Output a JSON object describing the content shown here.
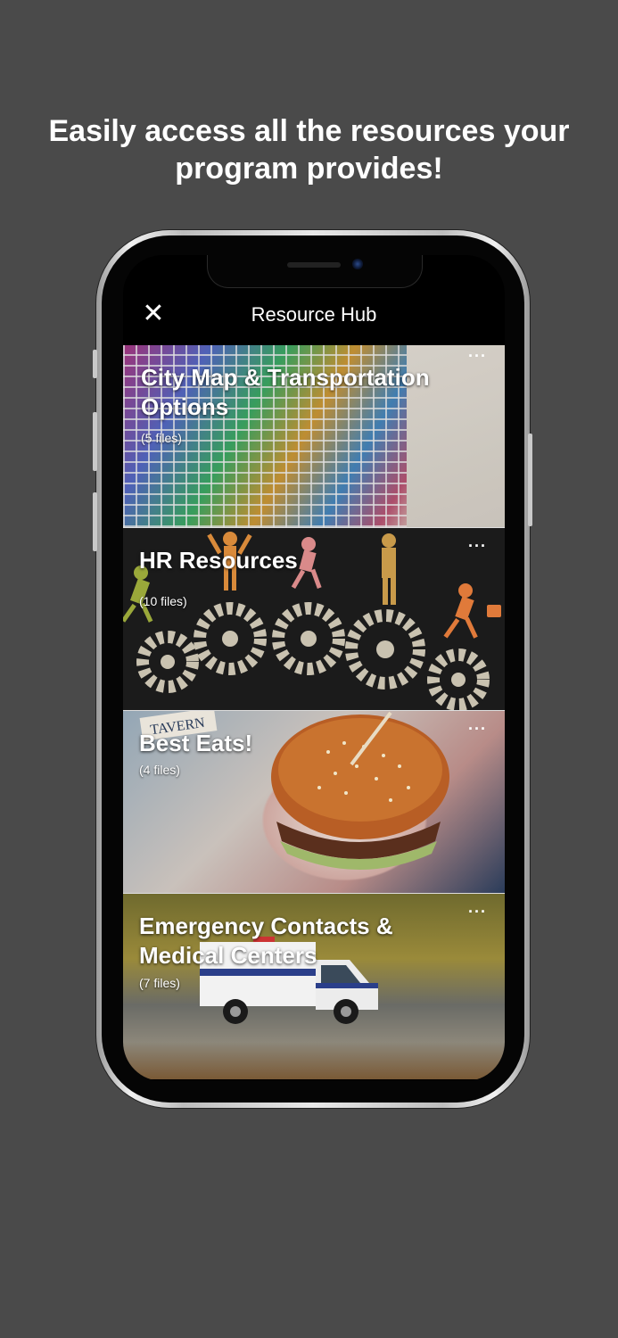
{
  "headline": {
    "line1": "Easily access all the resources your",
    "line2": "program provides!"
  },
  "navbar": {
    "close_icon": "close-icon",
    "title": "Resource Hub"
  },
  "resources": [
    {
      "title": "City Map & Transportation Options",
      "count": "(5 files)",
      "more": "···"
    },
    {
      "title": "HR Resources",
      "count": "(10 files)",
      "more": "···"
    },
    {
      "title": "Best Eats!",
      "count": "(4 files)",
      "more": "···"
    },
    {
      "title": "Emergency Contacts & Medical Centers",
      "count": "(7 files)",
      "more": "···"
    }
  ]
}
